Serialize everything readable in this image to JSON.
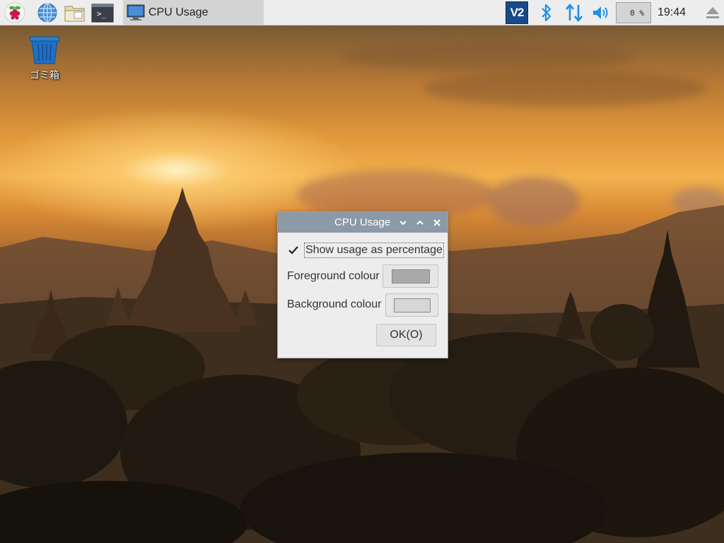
{
  "taskbar": {
    "launchers": [
      {
        "icon": "raspberry-menu-icon"
      },
      {
        "icon": "web-browser-icon"
      },
      {
        "icon": "file-manager-icon"
      },
      {
        "icon": "terminal-icon"
      }
    ],
    "terminal_glyph": ">_",
    "task_title": "CPU Usage",
    "vnc_label": "V2",
    "cpu_monitor": "0 %",
    "clock": "19:44",
    "accent": "#1e90e6"
  },
  "desktop": {
    "trash_label": "ゴミ箱"
  },
  "dialog": {
    "title": "CPU Usage",
    "show_percentage_label": "Show usage as percentage",
    "show_percentage_checked": true,
    "foreground_label": "Foreground colour",
    "foreground_color": "#a9a9a9",
    "background_label": "Background colour",
    "background_color": "#d6d6d6",
    "ok_label": "OK(O)"
  }
}
